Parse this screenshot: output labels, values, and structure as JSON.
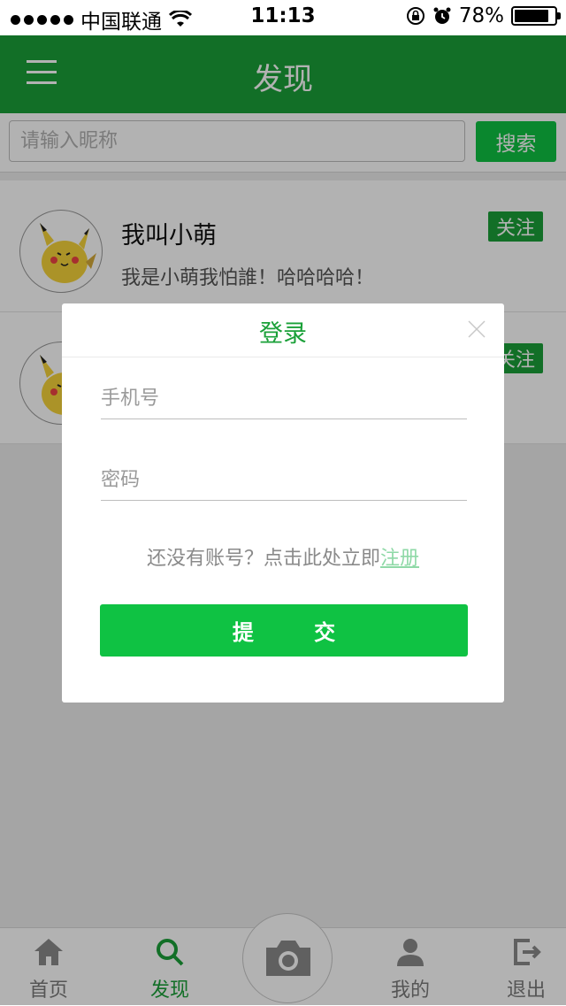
{
  "status_bar": {
    "carrier": "中国联通",
    "time": "11:13",
    "battery": "78%",
    "battery_level": 0.78
  },
  "header": {
    "title": "发现",
    "menu_icon": "menu-icon"
  },
  "search": {
    "placeholder": "请输入昵称",
    "button": "搜索"
  },
  "list": [
    {
      "nickname": "我叫小萌",
      "description": "我是小萌我怕誰！哈哈哈哈！",
      "follow": "关注"
    },
    {
      "nickname": "",
      "description": "",
      "follow": "关注"
    }
  ],
  "modal": {
    "title": "登录",
    "phone_placeholder": "手机号",
    "password_placeholder": "密码",
    "register_prompt": "还没有账号？点击此处立即",
    "register_link": "注册",
    "submit": "提 交"
  },
  "tabbar": {
    "home": "首页",
    "discover": "发现",
    "mine": "我的",
    "logout": "退出"
  },
  "colors": {
    "brand_green": "#1aa038",
    "button_green": "#0fc243"
  }
}
